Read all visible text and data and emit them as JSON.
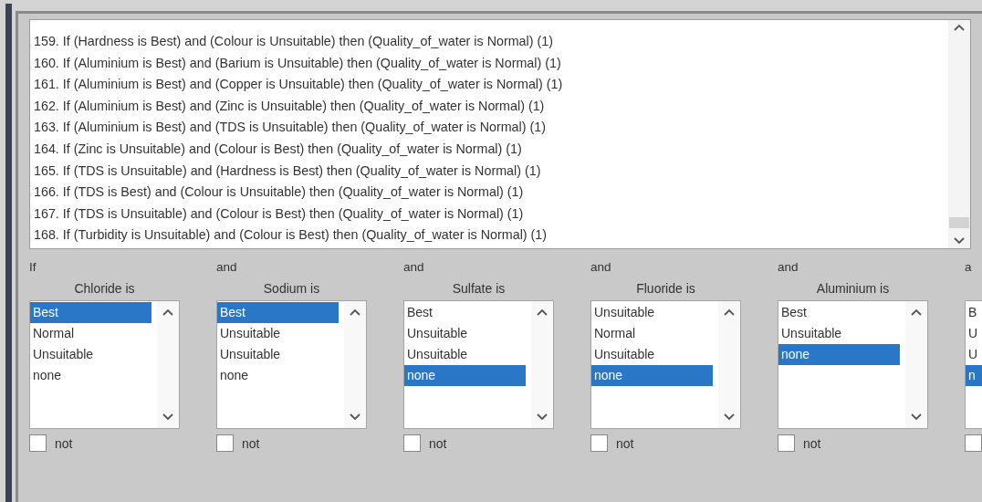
{
  "rules": {
    "items": [
      "159. If (Hardness is Best) and (Colour is Unsuitable) then (Quality_of_water is Normal) (1)",
      "160. If (Aluminium is Best) and (Barium is Unsuitable) then (Quality_of_water is Normal) (1)",
      "161. If (Aluminium is Best) and (Copper is Unsuitable) then (Quality_of_water is Normal) (1)",
      "162. If (Aluminium is Best) and (Zinc is Unsuitable) then (Quality_of_water is Normal) (1)",
      "163. If (Aluminium is Best) and (TDS is Unsuitable) then (Quality_of_water is Normal) (1)",
      "164. If (Zinc is Unsuitable) and (Colour is Best) then (Quality_of_water is Normal) (1)",
      "165. If (TDS is Unsuitable) and (Hardness is Best) then (Quality_of_water is Normal) (1)",
      "166. If (TDS is Best) and (Colour is Unsuitable) then (Quality_of_water is Normal) (1)",
      "167. If (TDS is Unsuitable) and (Colour is Best) then (Quality_of_water is Normal) (1)",
      "168. If (Turbidity is Unsuitable) and (Colour is Best) then (Quality_of_water is Normal) (1)"
    ]
  },
  "conditions": [
    {
      "connector": "If",
      "label": "Chloride is",
      "options": [
        {
          "text": "Best",
          "selected": true
        },
        {
          "text": "Normal",
          "selected": false
        },
        {
          "text": "Unsuitable",
          "selected": false
        },
        {
          "text": "none",
          "selected": false
        }
      ],
      "not": {
        "label": "not",
        "checked": false
      }
    },
    {
      "connector": "and",
      "label": "Sodium is",
      "options": [
        {
          "text": "Best",
          "selected": true
        },
        {
          "text": "Unsuitable",
          "selected": false
        },
        {
          "text": "Unsuitable",
          "selected": false
        },
        {
          "text": "none",
          "selected": false
        }
      ],
      "not": {
        "label": "not",
        "checked": false
      }
    },
    {
      "connector": "and",
      "label": "Sulfate is",
      "options": [
        {
          "text": "Best",
          "selected": false
        },
        {
          "text": "Unsuitable",
          "selected": false
        },
        {
          "text": "Unsuitable",
          "selected": false
        },
        {
          "text": "none",
          "selected": true
        }
      ],
      "not": {
        "label": "not",
        "checked": false
      }
    },
    {
      "connector": "and",
      "label": "Fluoride is",
      "options": [
        {
          "text": "Unsuitable",
          "selected": false
        },
        {
          "text": "Normal",
          "selected": false
        },
        {
          "text": "Unsuitable",
          "selected": false
        },
        {
          "text": "none",
          "selected": true
        }
      ],
      "not": {
        "label": "not",
        "checked": false
      }
    },
    {
      "connector": "and",
      "label": "Aluminium is",
      "options": [
        {
          "text": "Best",
          "selected": false
        },
        {
          "text": "Unsuitable",
          "selected": false
        },
        {
          "text": "none",
          "selected": true
        }
      ],
      "not": {
        "label": "not",
        "checked": false
      }
    },
    {
      "connector": "a",
      "options": [
        {
          "text": "B",
          "selected": false
        },
        {
          "text": "U",
          "selected": false
        },
        {
          "text": "U",
          "selected": false
        },
        {
          "text": "n",
          "selected": true
        }
      ],
      "not": {
        "checked": false
      }
    }
  ]
}
